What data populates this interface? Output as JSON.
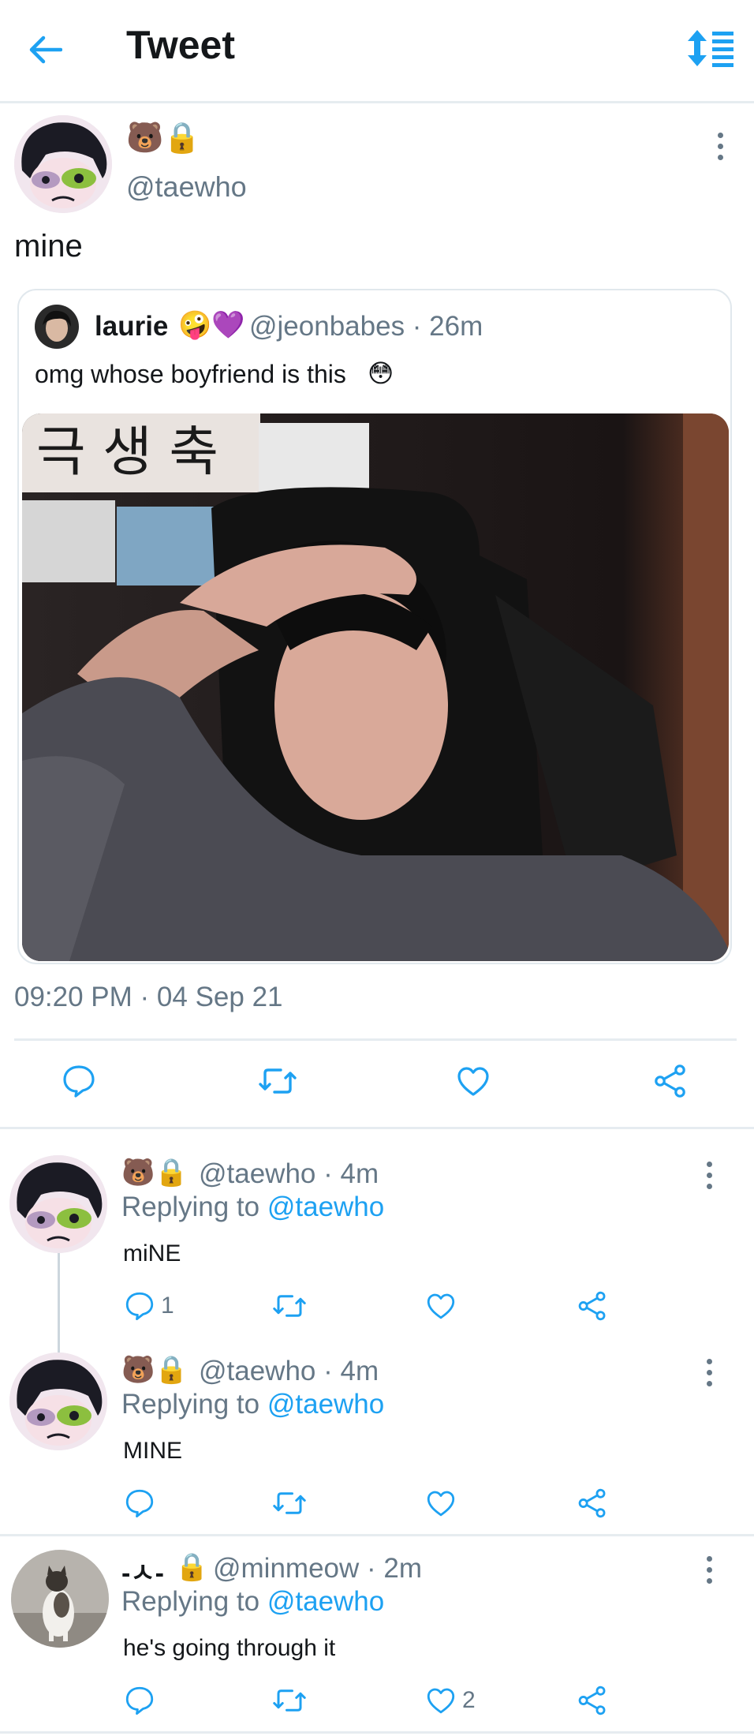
{
  "header": {
    "title": "Tweet"
  },
  "main_tweet": {
    "handle": "@taewho",
    "name_emoji": "🐻🔒",
    "text": "mine",
    "timestamp": "09:20 PM · 04 Sep 21",
    "quote": {
      "name": "laurie",
      "name_emoji": "🤪💜",
      "handle": "@jeonbabes · 26m",
      "text": "omg whose boyfriend is this",
      "text_emoji": "😳",
      "media_caption": "극 생 축"
    }
  },
  "replies": [
    {
      "name_emoji": "🐻🔒",
      "handle": "@taewho · 4m",
      "replying_prefix": "Replying to",
      "replying_to": "@taewho",
      "text": "miNE",
      "reply_count": "1",
      "like_count": ""
    },
    {
      "name_emoji": "🐻🔒",
      "handle": "@taewho · 4m",
      "replying_prefix": "Replying to",
      "replying_to": "@taewho",
      "text": "MINE",
      "reply_count": "",
      "like_count": ""
    },
    {
      "name": "-ㅅ-",
      "name_emoji": "🔒",
      "handle": "@minmeow · 2m",
      "replying_prefix": "Replying to",
      "replying_to": "@taewho",
      "text": "he's going through it",
      "reply_count": "",
      "like_count": "2"
    }
  ],
  "icons": {
    "back": "arrow-left-icon",
    "sort": "sort-icon",
    "reply": "comment-icon",
    "retweet": "retweet-icon",
    "like": "heart-icon",
    "share": "share-icon",
    "more": "more-vertical-icon",
    "lock": "lock-icon"
  },
  "colors": {
    "accent": "#1da1f2",
    "secondary_text": "#657786",
    "divider": "#e6ecf0"
  }
}
